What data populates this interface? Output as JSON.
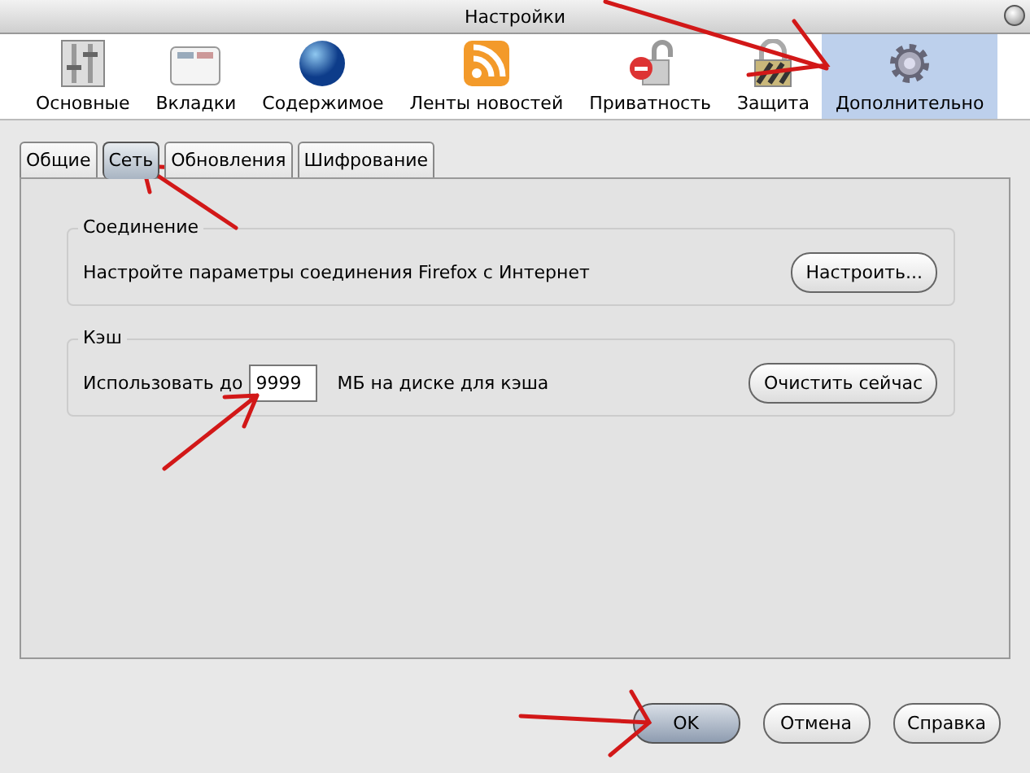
{
  "window": {
    "title": "Настройки"
  },
  "toolbar": [
    {
      "label": "Основные",
      "kind": "sliders",
      "selected": false
    },
    {
      "label": "Вкладки",
      "kind": "tabs",
      "selected": false
    },
    {
      "label": "Содержимое",
      "kind": "globe",
      "selected": false
    },
    {
      "label": "Ленты новостей",
      "kind": "feed",
      "selected": false
    },
    {
      "label": "Приватность",
      "kind": "unlock",
      "selected": false
    },
    {
      "label": "Защита",
      "kind": "lock",
      "selected": false
    },
    {
      "label": "Дополнительно",
      "kind": "gear",
      "selected": true
    }
  ],
  "tabs": [
    {
      "label": "Общие",
      "selected": false
    },
    {
      "label": "Сеть",
      "selected": true
    },
    {
      "label": "Обновления",
      "selected": false
    },
    {
      "label": "Шифрование",
      "selected": false
    }
  ],
  "groups": [
    {
      "title": "Соединение",
      "kind": "text",
      "text": "Настройте параметры соединения Firefox с Интернет",
      "button": "Настроить..."
    },
    {
      "title": "Кэш",
      "kind": "field",
      "label": "Использовать до",
      "value": "9999",
      "unit": "МБ на диске для кэша",
      "button": "Очистить сейчас"
    }
  ],
  "buttons": [
    {
      "label": "OK",
      "default": true
    },
    {
      "label": "Отмена",
      "default": false
    },
    {
      "label": "Справка",
      "default": false
    }
  ]
}
